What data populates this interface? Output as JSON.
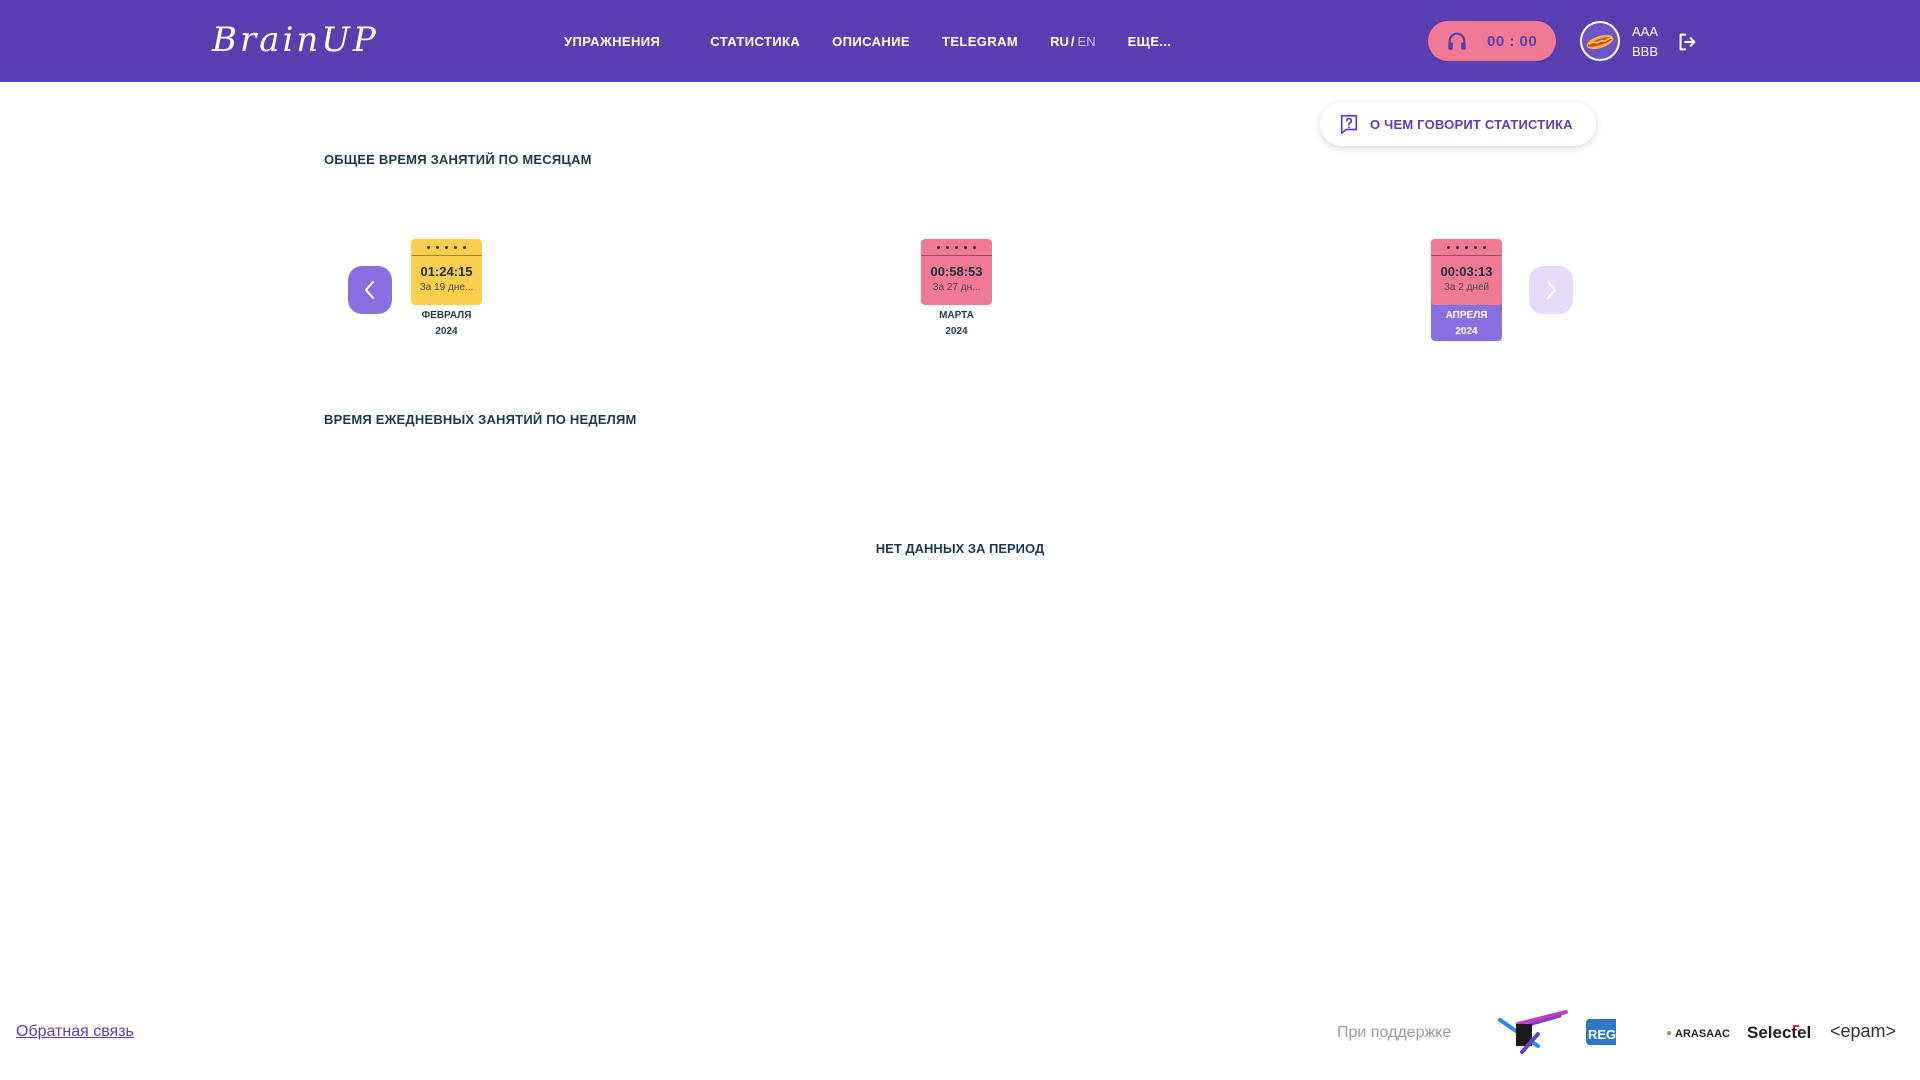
{
  "header": {
    "logo": "BrainUP",
    "nav": [
      "УПРАЖНЕНИЯ",
      "СТАТИСТИКА",
      "ОПИСАНИЕ",
      "TELEGRAM"
    ],
    "lang_ru": "RU",
    "lang_sep": "/",
    "lang_en": "EN",
    "more": "ЕЩЕ...",
    "timer": "00 : 00",
    "user_first": "AAA",
    "user_second": "BBB"
  },
  "help_button": "О ЧЕМ ГОВОРИТ СТАТИСТИКА",
  "monthly": {
    "title": "ОБЩЕЕ ВРЕМЯ ЗАНЯТИЙ ПО МЕСЯЦАМ",
    "months": [
      {
        "time": "01:24:15",
        "days": "За 19 дне...",
        "month": "ФЕВРАЛЯ",
        "year": "2024",
        "color": "#f9cf4d"
      },
      {
        "time": "00:58:53",
        "days": "За 27 дн...",
        "month": "МАРТА",
        "year": "2024",
        "color": "#f07a96"
      },
      {
        "time": "00:03:13",
        "days": "За 2 дней",
        "month": "АПРЕЛЯ",
        "year": "2024",
        "color": "#f07a96"
      }
    ]
  },
  "weekly": {
    "title": "ВРЕМЯ ЕЖЕДНЕВНЫХ ЗАНЯТИЙ ПО НЕДЕЛЯМ",
    "empty": "НЕТ ДАННЫХ ЗА ПЕРИОД"
  },
  "footer": {
    "feedback": "Обратная связь",
    "support": "При поддержке",
    "sponsors": [
      "REG.RU",
      "ARASAAC",
      "Selectel",
      "<epam>"
    ]
  }
}
